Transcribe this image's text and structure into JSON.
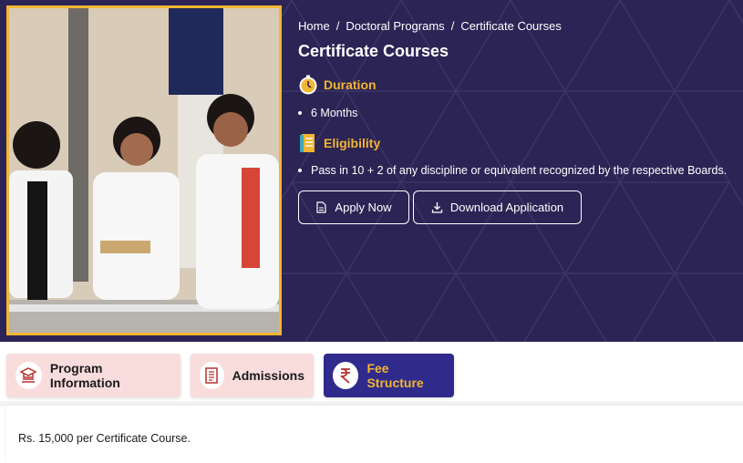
{
  "breadcrumb": [
    "Home",
    "Doctoral Programs",
    "Certificate Courses"
  ],
  "page_title": "Certificate Courses",
  "duration": {
    "heading": "Duration",
    "value": "6 Months",
    "icon": "stopwatch-icon"
  },
  "eligibility": {
    "heading": "Eligibility",
    "value": "Pass in 10 + 2 of any discipline or equivalent recognized by the respective Boards.",
    "icon": "document-icon"
  },
  "actions": {
    "apply": "Apply Now",
    "download": "Download Application"
  },
  "tabs": [
    {
      "label": "Program Information",
      "icon": "graduation-book-icon",
      "active": false
    },
    {
      "label": "Admissions",
      "icon": "form-icon",
      "active": false
    },
    {
      "label": "Fee Structure",
      "icon": "rupee-icon",
      "active": true
    }
  ],
  "fee_text": "Rs. 15,000 per Certificate Course.",
  "colors": {
    "hero_bg": "#2b2454",
    "accent": "#f2b632",
    "tab_active": "#2f2a8c",
    "tab_inactive": "#f9dcdc"
  }
}
